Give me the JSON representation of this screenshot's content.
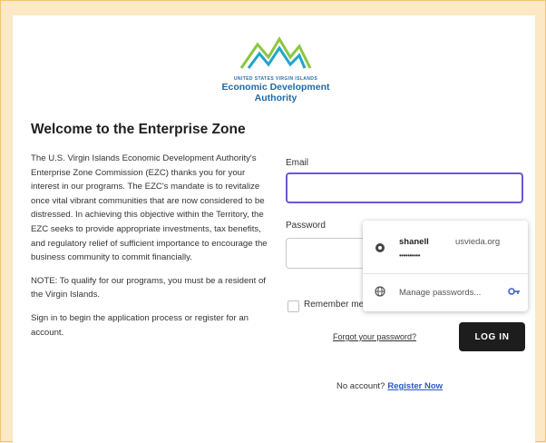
{
  "logo": {
    "small_text": "UNITED STATES VIRGIN ISLANDS",
    "line1": "Economic Development",
    "line2": "Authority"
  },
  "page": {
    "title": "Welcome to the Enterprise Zone",
    "paragraph1": "The U.S. Virgin Islands Economic Development Authority's Enterprise Zone Commission (EZC) thanks you for your interest in our programs. The EZC's mandate is to revitalize once vital vibrant communities that are now considered to be distressed. In achieving this objective within the Territory, the EZC seeks to provide appropriate investments, tax benefits, and regulatory relief of sufficient importance to encourage the business community to commit financially.",
    "paragraph2": "NOTE: To qualify for our programs, you must be a resident of the Virgin Islands.",
    "paragraph3": "Sign in to begin the application process or register for an account."
  },
  "form": {
    "email_label": "Email",
    "email_value": "",
    "password_label": "Password",
    "password_value": "",
    "remember_label": "Remember me",
    "forgot_link": "Forgot your password?",
    "login_button": "LOG IN",
    "no_account_text": "No account?",
    "register_link": "Register Now"
  },
  "autofill_popup": {
    "username": "shanell",
    "domain": "usvieda.org",
    "password_mask": "••••••••••",
    "manage_label": "Manage passwords..."
  },
  "colors": {
    "page_background": "#fbe8c4",
    "focus_border": "#6a5acd",
    "login_button_bg": "#1d1d1d",
    "link": "#2f58c8",
    "logo_blue": "#1f6aa6",
    "logo_green": "#8cc63f"
  }
}
